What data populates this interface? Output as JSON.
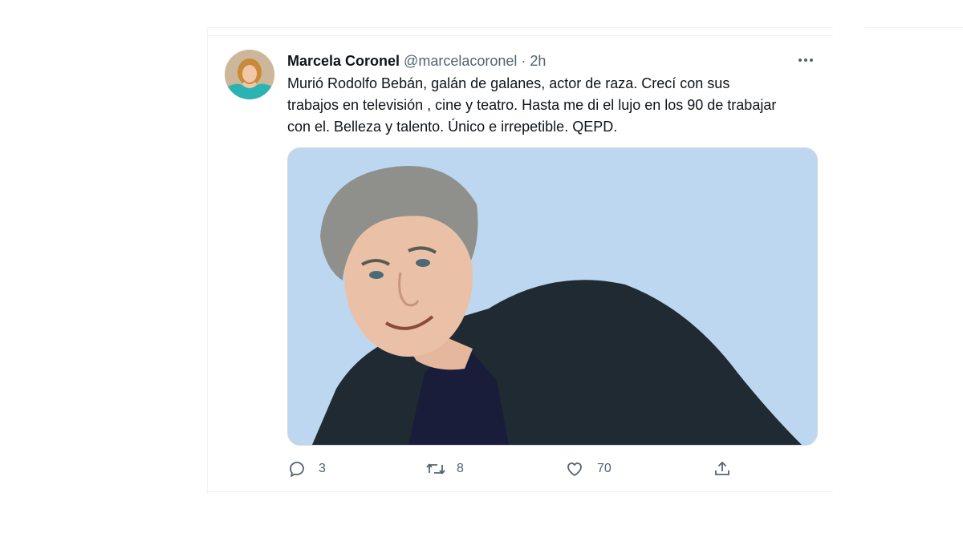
{
  "tweet": {
    "author_name": "Marcela Coronel",
    "author_handle": "@marcelacoronel",
    "separator": "·",
    "time": "2h",
    "text": "Murió Rodolfo Bebán, galán de galanes, actor de raza. Crecí con sus trabajos en televisión , cine y teatro. Hasta me di el lujo en los 90 de trabajar con el. Belleza y talento. Único e irrepetible. QEPD.",
    "media_background": "#bcd7ef",
    "icons": {
      "more": "more-options-icon",
      "reply": "reply-icon",
      "retweet": "retweet-icon",
      "like": "like-icon",
      "share": "share-icon"
    },
    "actions": {
      "replies": "3",
      "retweets": "8",
      "likes": "70"
    }
  }
}
